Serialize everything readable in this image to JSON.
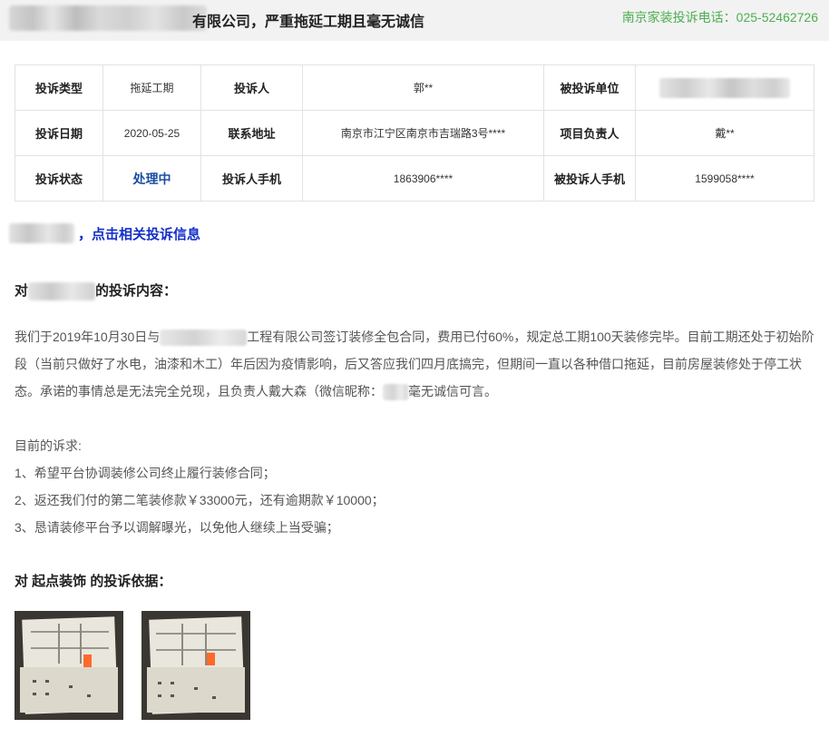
{
  "header": {
    "title_suffix": "有限公司，严重拖延工期且毫无诚信",
    "hotline": "南京家装投诉电话：025-52462726"
  },
  "info_table": {
    "rows": [
      {
        "l1": "投诉类型",
        "v1": "拖延工期",
        "l2": "投诉人",
        "v2": "郭**",
        "l3": "被投诉单位",
        "v3": ""
      },
      {
        "l1": "投诉日期",
        "v1": "2020-05-25",
        "l2": "联系地址",
        "v2": "南京市江宁区南京市吉瑞路3号****",
        "l3": "项目负责人",
        "v3": "戴**"
      },
      {
        "l1": "投诉状态",
        "v1": "处理中",
        "l2": "投诉人手机",
        "v2": "1863906****",
        "l3": "被投诉人手机",
        "v3": "1599058****"
      }
    ]
  },
  "related_link": "，点击相关投诉信息",
  "complaint_section": {
    "prefix": "对",
    "suffix": "的投诉内容：",
    "paragraph": {
      "part1": "我们于2019年10月30日与",
      "part2": "工程有限公司签订装修全包合同，费用已付60%，规定总工期100天装修完毕。目前工期还处于初始阶段（当前只做好了水电，油漆和木工）年后因为疫情影响，后又答应我们四月底搞完，但期间一直以各种借口拖延，目前房屋装修处于停工状态。承诺的事情总是无法完全兑现，且负责人戴大森（微信昵称：",
      "part3": "毫无诚信可言。"
    },
    "demands_title": "目前的诉求:",
    "demands": [
      "1、希望平台协调装修公司终止履行装修合同；",
      "2、返还我们付的第二笔装修款￥33000元，还有逾期款￥10000；",
      "3、恳请装修平台予以调解曝光，以免他人继续上当受骗；"
    ]
  },
  "evidence_section": {
    "title": "对 起点装饰 的投诉依据："
  },
  "colors": {
    "hotline": "#4caf50",
    "status": "#1a4fa3",
    "link": "#1530c8",
    "header_bg": "#f2f2f2"
  }
}
